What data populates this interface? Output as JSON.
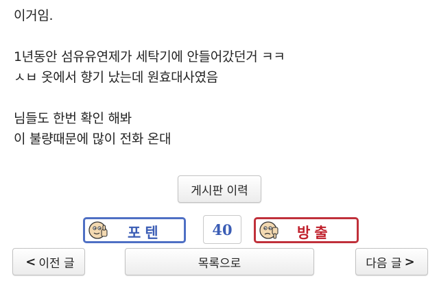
{
  "post": {
    "lines": [
      "이거임.",
      "",
      "1년동안 섬유유연제가 세탁기에 안들어갔던거 ㅋㅋ",
      "ㅅㅂ 옷에서 향기 났는데 원효대사였음",
      "",
      "님들도 한번 확인 해봐",
      "이 불량때문에 많이 전화 온대"
    ]
  },
  "actions": {
    "history_label": "게시판 이력",
    "upvote_label": "포텐",
    "downvote_label": "방출",
    "vote_count": "40",
    "prev_label": "이전 글",
    "list_label": "목록으로",
    "next_label": "다음 글"
  },
  "icons": {
    "upvote": "thumbs-up-face-icon",
    "downvote": "thumbs-down-face-icon",
    "prev": "chevron-left-icon",
    "next": "chevron-right-icon"
  },
  "colors": {
    "upvote_accent": "#3b5db5",
    "downvote_accent": "#c0202c",
    "count_color": "#3b5db5"
  }
}
